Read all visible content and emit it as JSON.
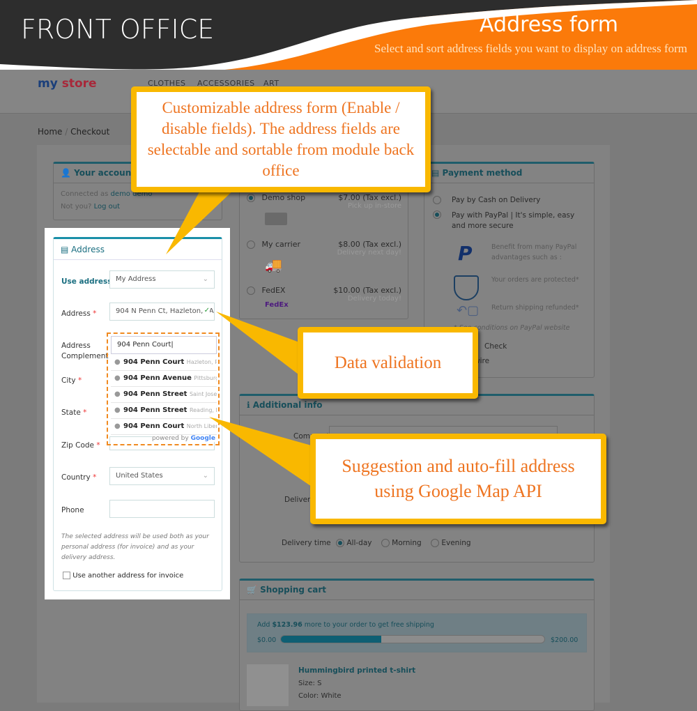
{
  "banner": {
    "left_title": "FRONT OFFICE",
    "title": "Address form",
    "subtitle": "Select and sort address fields you want to display on address form"
  },
  "store": {
    "logo_a": "my",
    "logo_b": "store",
    "nav": [
      "CLOTHES",
      "ACCESSORIES",
      "ART"
    ]
  },
  "breadcrumb": {
    "home": "Home",
    "sep": "/",
    "current": "Checkout"
  },
  "account": {
    "title": "Your account",
    "connected_as": "Connected as",
    "user": "demo demo",
    "not_you": "Not you?",
    "logout": "Log out"
  },
  "address": {
    "title": "Address",
    "use_address_label": "Use address",
    "use_address_value": "My Address",
    "address_label": "Address",
    "address_value": "904 N Penn Ct, Hazleton, PA",
    "complement_label": "Address Complement",
    "complement_value": "904 Penn Court",
    "city_label": "City",
    "state_label": "State",
    "zip_label": "Zip Code",
    "country_label": "Country",
    "country_value": "United States",
    "phone_label": "Phone",
    "required_mark": "*",
    "note": "The selected address will be used both as your personal address (for invoice) and as your delivery address.",
    "invoice_checkbox": "Use another address for invoice",
    "suggestions": [
      {
        "main": "904 Penn Court",
        "sub": "Hazleton, P..."
      },
      {
        "main": "904 Penn Avenue",
        "sub": "Pittsburgh..."
      },
      {
        "main": "904 Penn Street",
        "sub": "Saint Josep..."
      },
      {
        "main": "904 Penn Street",
        "sub": "Reading, P..."
      },
      {
        "main": "904 Penn Court",
        "sub": "North Liberty..."
      }
    ],
    "powered_by": "powered by",
    "google": "Google"
  },
  "shipping": {
    "carriers": [
      {
        "name": "Demo shop",
        "price": "$7.00 (Tax excl.)",
        "delay": "Pick up in-store",
        "selected": true
      },
      {
        "name": "My carrier",
        "price": "$8.00 (Tax excl.)",
        "delay": "Delivery next day!",
        "selected": false
      },
      {
        "name": "FedEX",
        "price": "$10.00 (Tax excl.)",
        "delay": "Delivery today!",
        "selected": false,
        "logo": "FedEx"
      }
    ]
  },
  "payment": {
    "title": "Payment method",
    "options": [
      {
        "label": "Pay by Cash on Delivery",
        "selected": false
      },
      {
        "label": "Pay with PayPal | It's simple, easy and more secure",
        "selected": true
      }
    ],
    "benefits": [
      "Benefit from many PayPal advantages such as :",
      "Your orders are protected*",
      "Return shipping refunded*"
    ],
    "conditions": "* See conditions on PayPal website",
    "check": "Check",
    "bankwire": "Bank wire"
  },
  "additional": {
    "title": "Additional info",
    "comment_label": "Comment",
    "delivery_label": "Delivery date",
    "delivery_time_label": "Delivery time",
    "times": [
      {
        "label": "All-day",
        "selected": true
      },
      {
        "label": "Morning",
        "selected": false
      },
      {
        "label": "Evening",
        "selected": false
      }
    ]
  },
  "cart": {
    "title": "Shopping cart",
    "free_prefix": "Add",
    "free_amount": "$123.96",
    "free_suffix": "more to your order to get free shipping",
    "min": "$0.00",
    "max": "$200.00",
    "progress": 0.38,
    "product": {
      "name": "Hummingbird printed t-shirt",
      "size": "Size: S",
      "color": "Color: White"
    }
  },
  "callouts": {
    "customizable": "Customizable address form (Enable / disable fields). The address fields are selectable and sortable from module back office",
    "validation": "Data validation",
    "suggestion": "Suggestion and auto-fill address using Google Map API"
  },
  "colors": {
    "accent": "#1a8fa8",
    "callout_border": "#f9b800",
    "callout_text": "#ee7420",
    "banner_orange": "#fb7a0a"
  }
}
